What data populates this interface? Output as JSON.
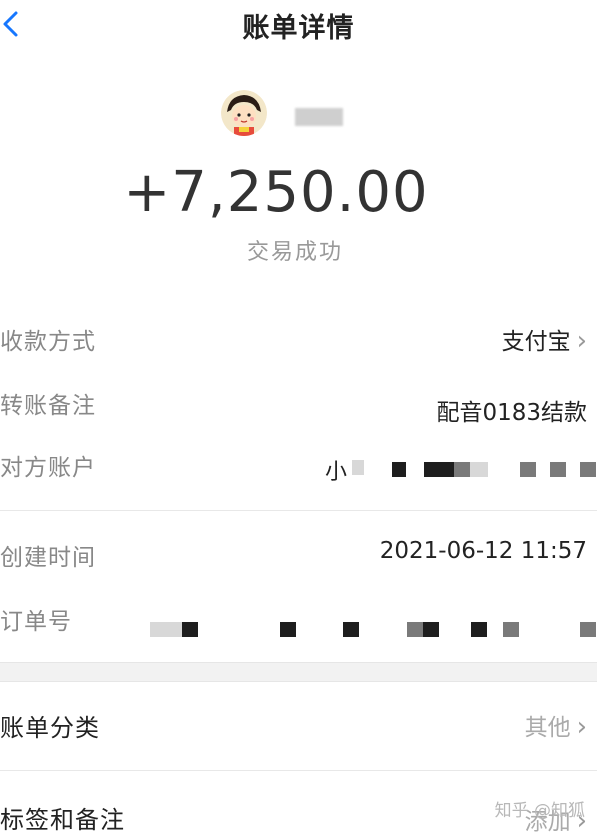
{
  "nav": {
    "title": "账单详情"
  },
  "header": {
    "amount": "+7,250.00",
    "status": "交易成功"
  },
  "details": {
    "pay_method": {
      "label": "收款方式",
      "value": "支付宝"
    },
    "remark": {
      "label": "转账备注",
      "value": "配音0183结款"
    },
    "counterparty": {
      "label": "对方账户",
      "value_prefix": "小"
    },
    "created_time": {
      "label": "创建时间",
      "value": "2021-06-12 11:57"
    },
    "order_no": {
      "label": "订单号"
    }
  },
  "sections": {
    "category": {
      "label": "账单分类",
      "value": "其他"
    },
    "tags": {
      "label": "标签和备注",
      "value": "添加"
    }
  },
  "watermark": "知乎 @知狐",
  "colors": {
    "accent": "#1677ff",
    "text": "#222222",
    "muted": "#888888"
  },
  "icons": [
    "chevron-left-icon",
    "chevron-right-icon",
    "avatar"
  ]
}
